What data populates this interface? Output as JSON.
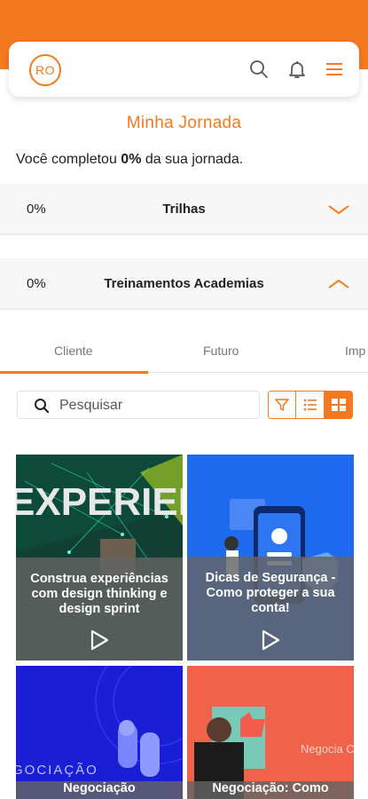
{
  "header": {
    "logo_text": "RO",
    "icons": [
      "search-icon",
      "bell-icon",
      "menu-icon"
    ]
  },
  "journey": {
    "title": "Minha Jornada",
    "progress_prefix": "Você completou ",
    "progress_value": "0%",
    "progress_suffix": " da sua jornada."
  },
  "sections": [
    {
      "percent": "0%",
      "label": "Trilhas",
      "expanded": false
    },
    {
      "percent": "0%",
      "label": "Treinamentos Academias",
      "expanded": true
    }
  ],
  "tabs": [
    {
      "label": "Cliente",
      "active": true
    },
    {
      "label": "Futuro",
      "active": false
    },
    {
      "label": "Imp",
      "active": false
    }
  ],
  "search": {
    "placeholder": "Pesquisar"
  },
  "view_controls": [
    "filter-icon",
    "list-view-icon",
    "grid-view-icon"
  ],
  "cards": [
    {
      "title": "Construa experiências com design thinking e design sprint",
      "art_text": "EXPERIENCIA"
    },
    {
      "title": "Dicas de Segurança - Como proteger a sua conta!"
    },
    {
      "title": "Negociação",
      "art_text": "GOCIAÇÃO"
    },
    {
      "title": "Negociação: Como",
      "art_text": "Negocia Como a o métoc"
    }
  ],
  "colors": {
    "accent": "#f47920",
    "card_overlay": "#646464"
  }
}
